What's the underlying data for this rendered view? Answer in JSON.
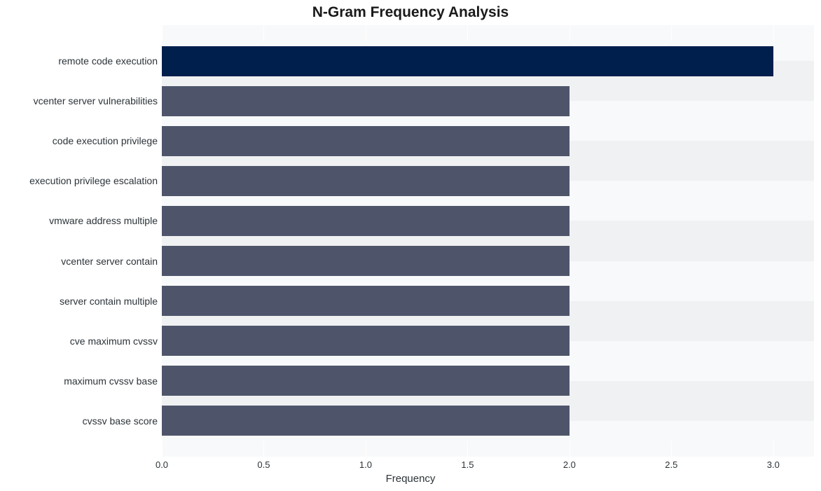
{
  "chart_data": {
    "type": "bar",
    "orientation": "horizontal",
    "title": "N-Gram Frequency Analysis",
    "xlabel": "Frequency",
    "ylabel": "",
    "xlim": [
      0.0,
      3.2
    ],
    "xticks": [
      0.0,
      0.5,
      1.0,
      1.5,
      2.0,
      2.5,
      3.0
    ],
    "categories": [
      "remote code execution",
      "vcenter server vulnerabilities",
      "code execution privilege",
      "execution privilege escalation",
      "vmware address multiple",
      "vcenter server contain",
      "server contain multiple",
      "cve maximum cvssv",
      "maximum cvssv base",
      "cvssv base score"
    ],
    "values": [
      3,
      2,
      2,
      2,
      2,
      2,
      2,
      2,
      2,
      2
    ],
    "colors": {
      "highlight": "#001f4d",
      "normal": "#4e556b"
    }
  }
}
